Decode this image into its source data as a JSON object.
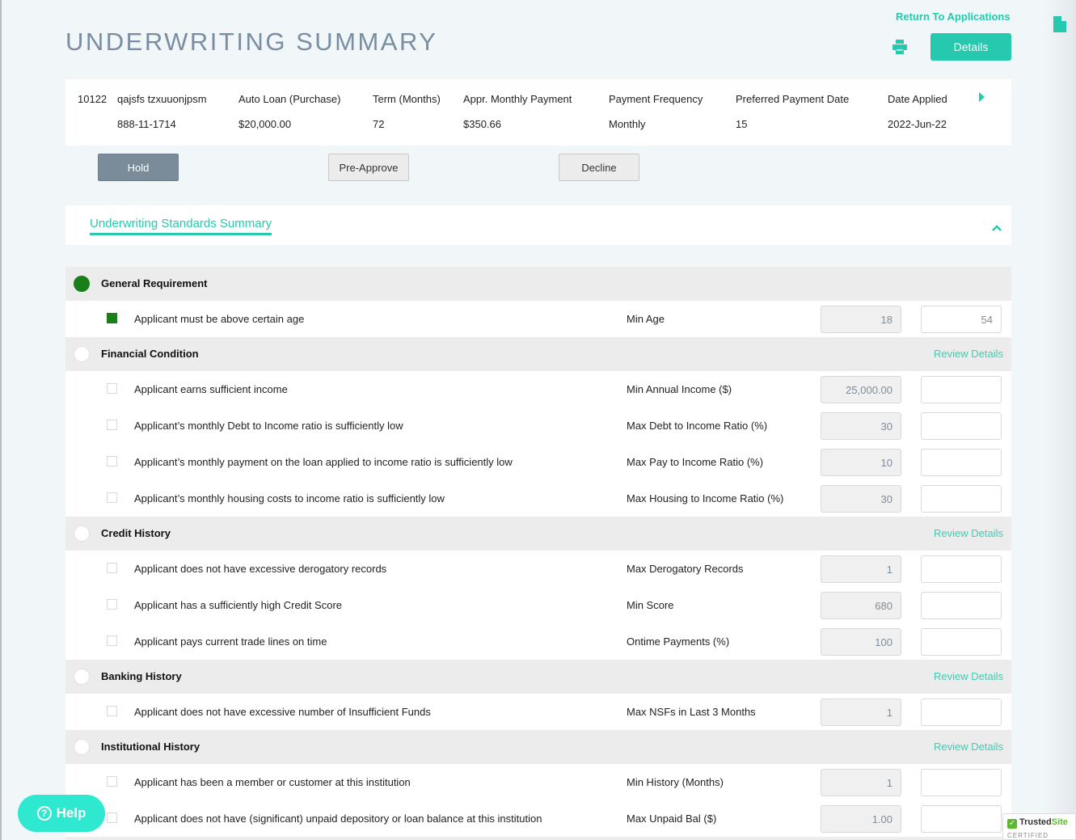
{
  "header": {
    "title": "UNDERWRITING SUMMARY",
    "return_link": "Return To Applications",
    "details_button": "Details"
  },
  "application": {
    "id": "10122",
    "applicant_name": "qajsfs tzxuuonjpsm",
    "ssn": "888-11-1714",
    "loan_type": "Auto Loan (Purchase)",
    "loan_amount": "$20,000.00",
    "columns": [
      {
        "label": "Term (Months)",
        "value": "72"
      },
      {
        "label": "Appr. Monthly Payment",
        "value": "$350.66"
      },
      {
        "label": "Payment Frequency",
        "value": "Monthly"
      },
      {
        "label": "Preferred Payment Date",
        "value": "15"
      },
      {
        "label": "Date Applied",
        "value": "2022-Jun-22"
      }
    ]
  },
  "actions": {
    "hold": "Hold",
    "pre_approve": "Pre-Approve",
    "decline": "Decline"
  },
  "tabs": {
    "active": "Underwriting Standards Summary"
  },
  "categories": [
    {
      "name": "General Requirement",
      "met": true,
      "review_link": "",
      "criteria": [
        {
          "label": "Applicant must be above certain age",
          "metric": "Min Age",
          "standard": "18",
          "actual": "54",
          "met": true
        }
      ]
    },
    {
      "name": "Financial Condition",
      "met": false,
      "review_link": "Review Details",
      "criteria": [
        {
          "label": "Applicant earns sufficient income",
          "metric": "Min Annual Income ($)",
          "standard": "25,000.00",
          "actual": "",
          "met": false
        },
        {
          "label": "Applicant’s monthly Debt to Income ratio is sufficiently low",
          "metric": "Max Debt to Income Ratio (%)",
          "standard": "30",
          "actual": "",
          "met": false
        },
        {
          "label": "Applicant’s monthly payment on the loan applied to income ratio is sufficiently low",
          "metric": "Max Pay to Income Ratio (%)",
          "standard": "10",
          "actual": "",
          "met": false
        },
        {
          "label": "Applicant’s monthly housing costs to income ratio is sufficiently low",
          "metric": "Max Housing to Income Ratio (%)",
          "standard": "30",
          "actual": "",
          "met": false
        }
      ]
    },
    {
      "name": "Credit History",
      "met": false,
      "review_link": "Review Details",
      "criteria": [
        {
          "label": "Applicant does not have excessive derogatory records",
          "metric": "Max Derogatory Records",
          "standard": "1",
          "actual": "",
          "met": false
        },
        {
          "label": "Applicant has a sufficiently high Credit Score",
          "metric": "Min Score",
          "standard": "680",
          "actual": "",
          "met": false
        },
        {
          "label": "Applicant pays current trade lines on time",
          "metric": "Ontime Payments (%)",
          "standard": "100",
          "actual": "",
          "met": false
        }
      ]
    },
    {
      "name": "Banking History",
      "met": false,
      "review_link": "Review Details",
      "criteria": [
        {
          "label": "Applicant does not have excessive number of Insufficient Funds",
          "metric": "Max NSFs in Last 3 Months",
          "standard": "1",
          "actual": "",
          "met": false
        }
      ]
    },
    {
      "name": "Institutional History",
      "met": false,
      "review_link": "Review Details",
      "criteria": [
        {
          "label": "Applicant has been a member or customer at this institution",
          "metric": "Min History (Months)",
          "standard": "1",
          "actual": "",
          "met": false
        },
        {
          "label": "Applicant does not have (significant) unpaid depository or loan balance at this institution",
          "metric": "Max Unpaid Bal ($)",
          "standard": "1.00",
          "actual": "",
          "met": false
        }
      ]
    }
  ],
  "help": {
    "label": "Help",
    "icon": "question-circle-icon"
  },
  "badge": {
    "name_a": "Trusted",
    "name_b": "Site",
    "subtitle": "CERTIFIED SECURE"
  },
  "colors": {
    "accent": "#26c9ae",
    "met_green": "#1a7f1a",
    "title_gray": "#7a8ea3",
    "hold_button": "#7a8b9a",
    "help_button": "#2ee8d0"
  }
}
